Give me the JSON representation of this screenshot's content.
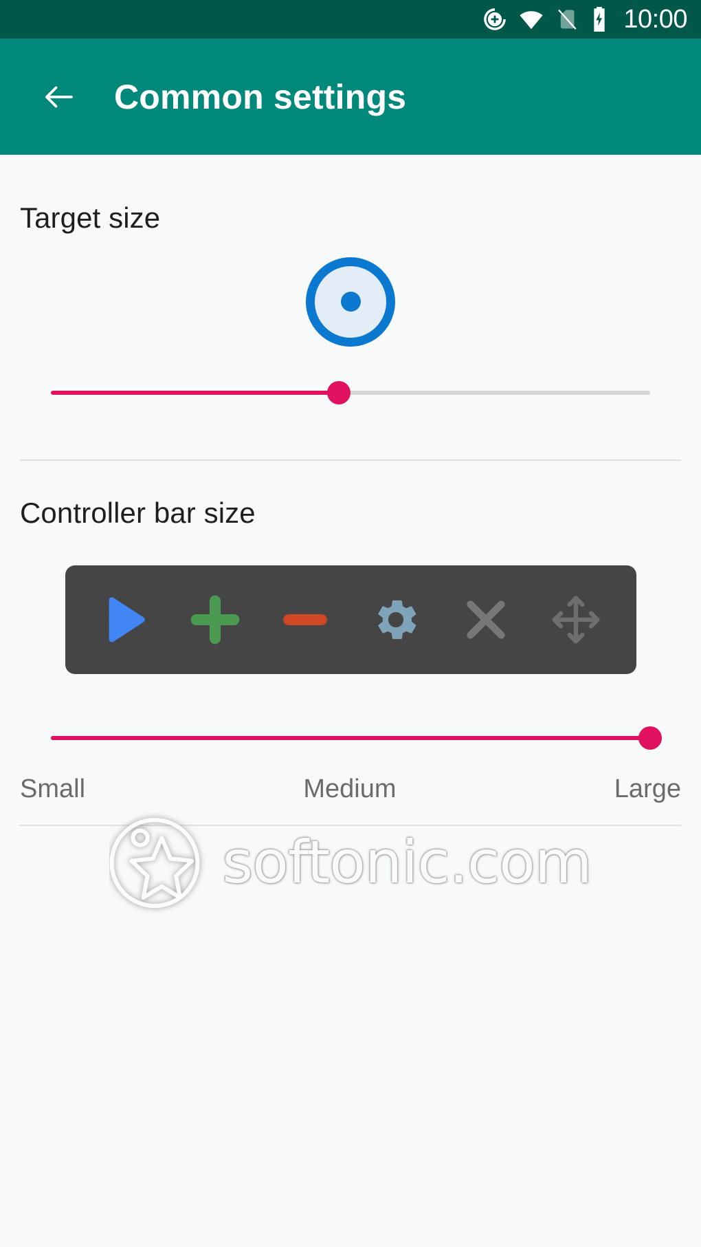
{
  "status_bar": {
    "clock": "10:00",
    "icons": [
      {
        "name": "data-saver-plus-icon",
        "label": "data saver"
      },
      {
        "name": "wifi-icon",
        "label": "wifi full signal"
      },
      {
        "name": "no-sim-icon",
        "label": "no sim card"
      },
      {
        "name": "battery-charging-icon",
        "label": "battery charging"
      }
    ],
    "background": "#00574a"
  },
  "app_bar": {
    "title": "Common settings",
    "back_icon": "back-arrow-icon",
    "background": "#00897b",
    "text_color": "#ffffff"
  },
  "sections": {
    "target_size": {
      "title": "Target size",
      "preview": {
        "ring_color": "#0B79D0",
        "fill_color": "#E3EDF8",
        "dot_color": "#0B79D0"
      },
      "slider": {
        "name": "target-size-slider",
        "value_percent": 48,
        "accent": "#e0115f",
        "track": "#d6d6d6"
      }
    },
    "controller_bar_size": {
      "title": "Controller bar size",
      "bar_background": "#454545",
      "buttons": [
        {
          "name": "play-icon",
          "label": "Play",
          "color": "#4285F4"
        },
        {
          "name": "plus-icon",
          "label": "Increase",
          "color": "#4A9B51"
        },
        {
          "name": "minus-icon",
          "label": "Decrease",
          "color": "#D24724"
        },
        {
          "name": "gear-icon",
          "label": "Settings",
          "color": "#7FA3B9"
        },
        {
          "name": "close-icon",
          "label": "Close",
          "color": "#777777"
        },
        {
          "name": "move-icon",
          "label": "Move",
          "color": "#6E6E6E"
        }
      ],
      "slider": {
        "name": "controller-bar-size-slider",
        "value_percent": 100,
        "accent": "#e0115f",
        "track": "#d6d6d6"
      },
      "scale_labels": [
        "Small",
        "Medium",
        "Large"
      ]
    }
  },
  "watermark": {
    "text": "softonic.com",
    "logo": "softonic-star-logo"
  }
}
